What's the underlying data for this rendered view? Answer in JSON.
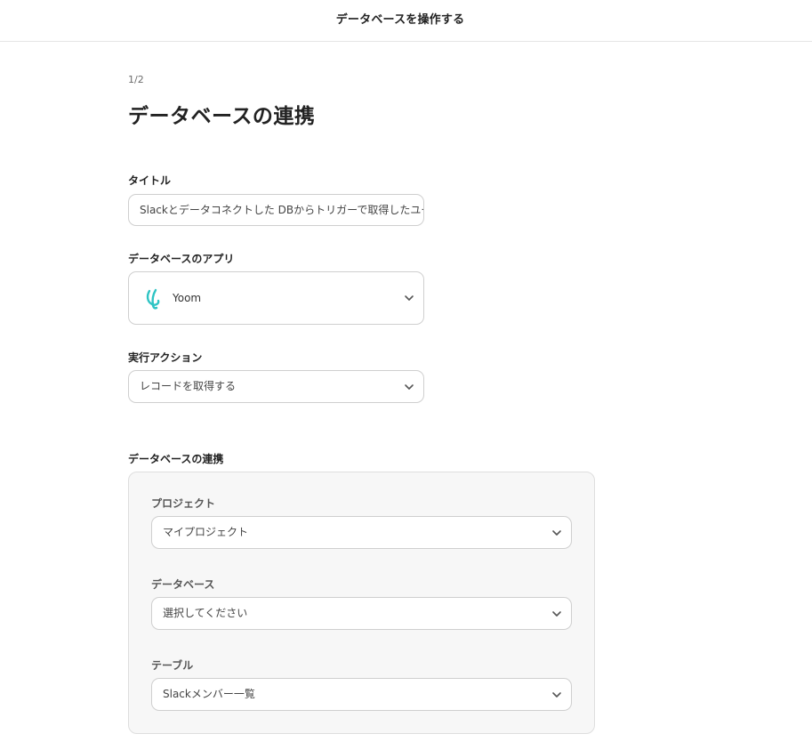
{
  "header": {
    "title": "データベースを操作する"
  },
  "page": {
    "step": "1/2",
    "title": "データベースの連携"
  },
  "form": {
    "title_label": "タイトル",
    "title_value": "Slackとデータコネクトした DBからトリガーで取得したユーザー",
    "app_label": "データベースのアプリ",
    "app_icon": "yoom-logo",
    "app_value": "Yoom",
    "action_label": "実行アクション",
    "action_value": "レコードを取得する"
  },
  "db_link": {
    "section_label": "データベースの連携",
    "project_label": "プロジェクト",
    "project_value": "マイプロジェクト",
    "database_label": "データベース",
    "database_value": "選択してください",
    "table_label": "テーブル",
    "table_value": "Slackメンバー一覧"
  },
  "colors": {
    "accent": "#2ec4c4",
    "border": "#cfcfcf",
    "panel_bg": "#f7f7f7"
  }
}
